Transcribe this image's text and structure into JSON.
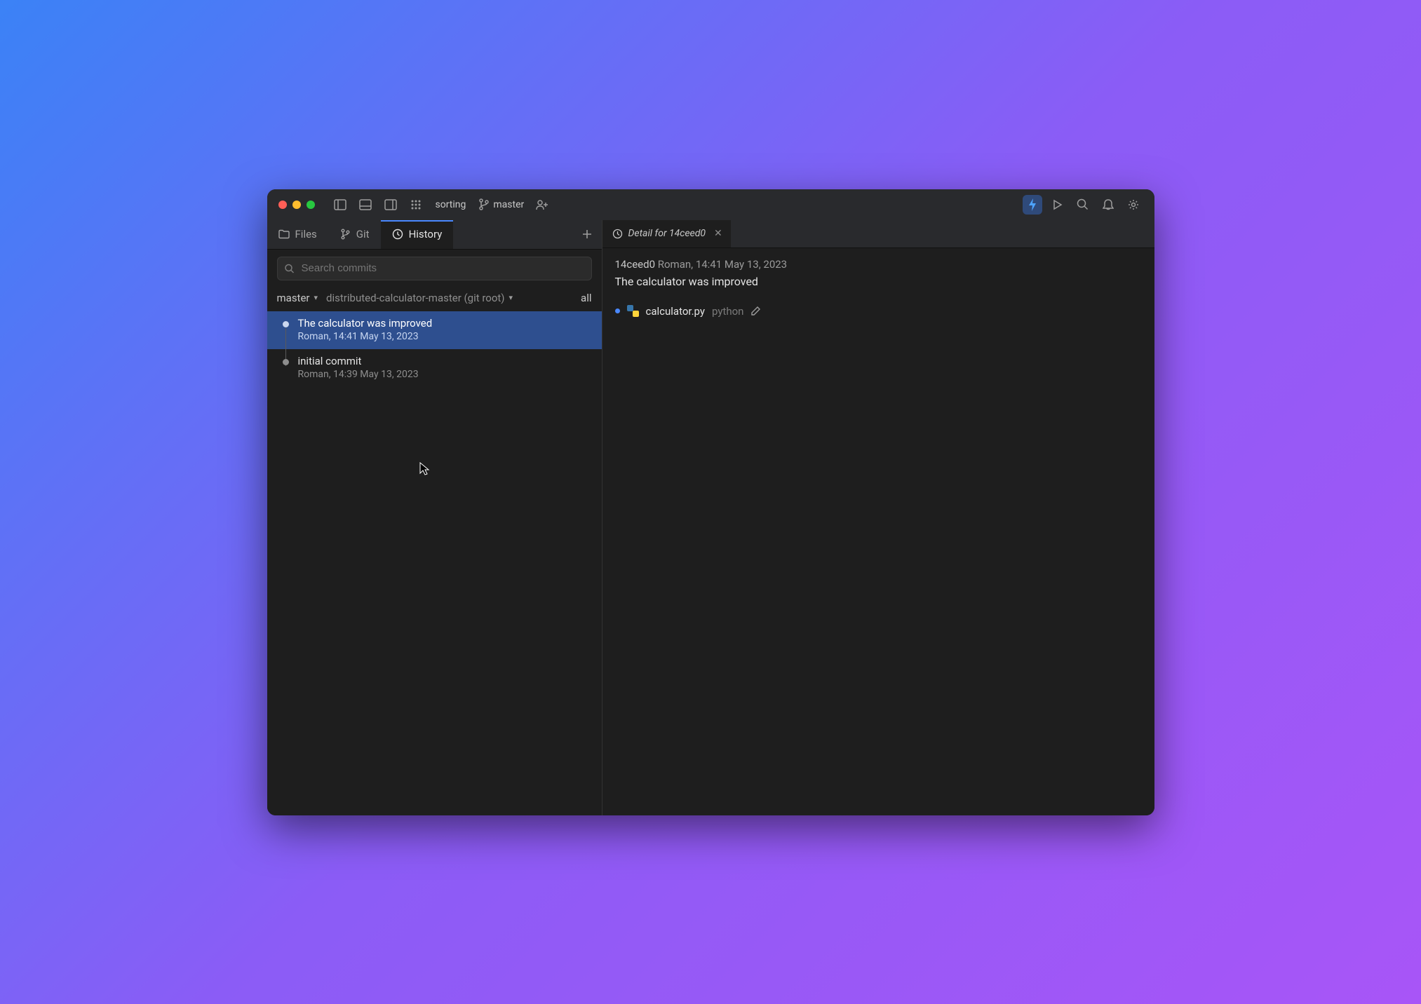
{
  "project_name": "sorting",
  "branch_name": "master",
  "sidebar_tabs": {
    "files": "Files",
    "git": "Git",
    "history": "History"
  },
  "search": {
    "placeholder": "Search commits"
  },
  "filters": {
    "branch": "master",
    "root": "distributed-calculator-master (git root)",
    "all": "all"
  },
  "commits": [
    {
      "title": "The calculator was improved",
      "meta": "Roman, 14:41 May 13, 2023",
      "selected": true
    },
    {
      "title": "initial commit",
      "meta": "Roman, 14:39 May 13, 2023",
      "selected": false
    }
  ],
  "detail": {
    "tab_label": "Detail for 14ceed0",
    "hash": "14ceed0",
    "author_time": "Roman, 14:41 May 13, 2023",
    "message": "The calculator was improved",
    "files": [
      {
        "name": "calculator.py",
        "path": "python"
      }
    ]
  }
}
